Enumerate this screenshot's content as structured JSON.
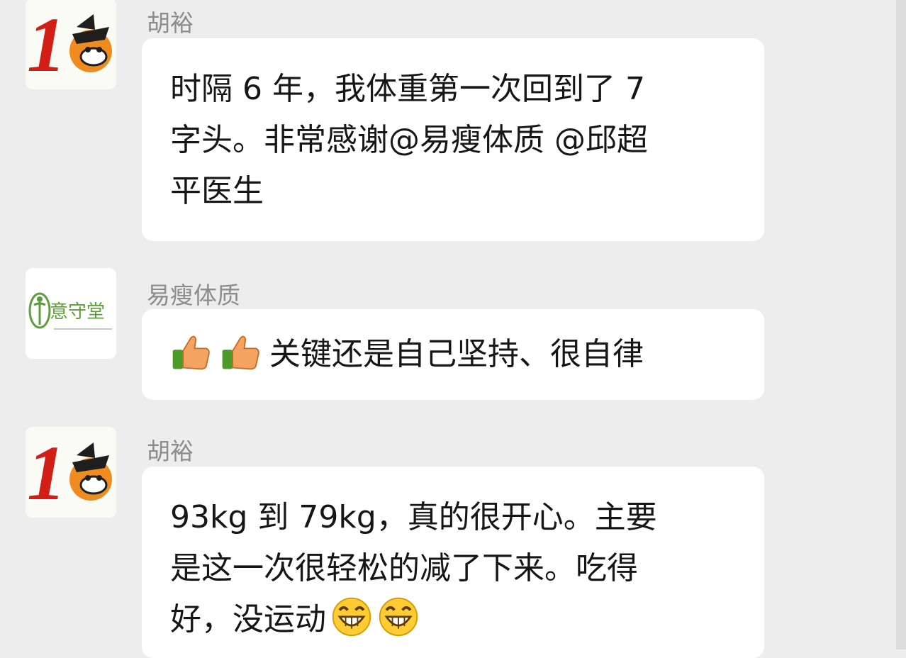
{
  "messages": [
    {
      "sender": "胡裕",
      "lines": [
        "时隔 6 年，我体重第一次回到了 7",
        "字头。非常感谢@易瘦体质 @邱超",
        "平医生"
      ],
      "avatar": {
        "glyph": "1"
      }
    },
    {
      "sender": "易瘦体质",
      "text": "关键还是自己坚持、很自律",
      "leading_icons": [
        "thumbs-up-icon",
        "thumbs-up-icon"
      ],
      "avatar": {
        "name": "意守堂"
      }
    },
    {
      "sender": "胡裕",
      "lines": [
        "93kg 到 79kg，真的很开心。主要",
        "是这一次很轻松的减了下来。吃得",
        "好，没运动"
      ],
      "trailing_icons": [
        "grinning-face-icon",
        "grinning-face-icon"
      ],
      "avatar": {
        "glyph": "1"
      }
    }
  ],
  "colors": {
    "background": "#ededed",
    "bubble": "#ffffff",
    "sender_text": "#8c8c8c",
    "avatar_red": "#d11f16",
    "avatar_orange": "#f08c1f",
    "logo_green": "#5b9e3a"
  }
}
